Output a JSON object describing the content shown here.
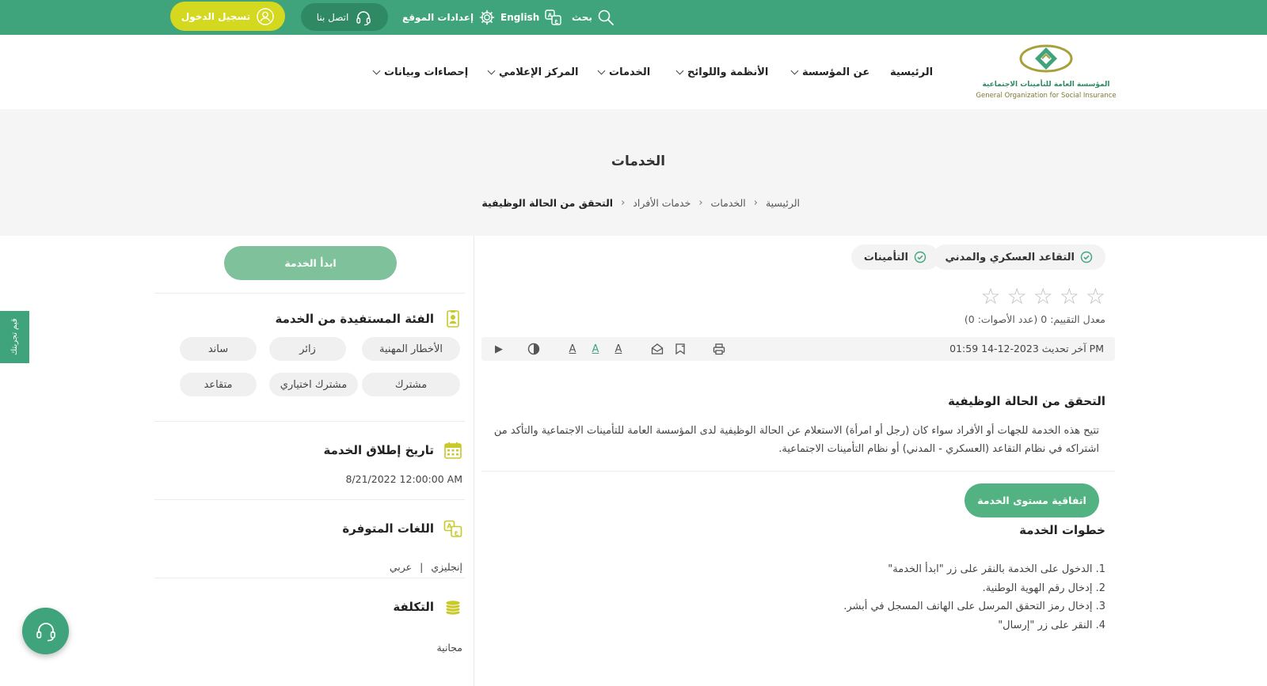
{
  "topbar": {
    "login_label": "تسجيل الدخول",
    "contact_label": "اتصل بنا",
    "settings_label": "إعدادات الموقع",
    "language_label": "English",
    "search_label": "بحث"
  },
  "header": {
    "logo_ar": "المؤسسة العامة للتأمينات الاجتماعية",
    "logo_en": "General Organization for Social Insurance",
    "nav": {
      "home": "الرئيسية",
      "about": "عن المؤسسة",
      "regulations": "الأنظمة واللوائح",
      "services": "الخدمات",
      "media": "المركز الإعلامي",
      "statistics": "إحصاءات وبيانات"
    }
  },
  "banner": {
    "title": "الخدمات",
    "breadcrumb": {
      "home": "الرئيسية",
      "services": "الخدمات",
      "individuals": "خدمات الأفراد",
      "current": "التحقق من الحالة الوظيفية",
      "separator": "›"
    }
  },
  "side_tab": {
    "label": "قيم تجربتك"
  },
  "sidebar": {
    "start_label": "ابدأ الخدمة",
    "beneficiaries_title": "الفئة المستفيدة من الخدمة",
    "beneficiaries": [
      "الأخطار المهنية",
      "زائر",
      "ساند",
      "مشترك",
      "مشترك اختياري",
      "متقاعد"
    ],
    "launch_title": "تاريخ إطلاق الخدمة",
    "launch_value": "8/21/2022 12:00:00 AM",
    "languages_title": "اللغات المتوفرة",
    "languages": [
      "إنجليزي",
      "عربي"
    ],
    "languages_separator": "|",
    "cost_title": "التكلفة",
    "cost_value": "مجانية"
  },
  "main": {
    "tags": [
      "التقاعد العسكري والمدني",
      "التأمينات"
    ],
    "stars_total": 5,
    "star_glyph": "☆",
    "rating_text": "معدل التقييم: 0 (عدد الأصوات: 0)",
    "last_update": "آخر تحديث 2023-12-14 01:59 PM",
    "toolbar": {
      "play": "▶",
      "font_down": "A",
      "font_reset": "A",
      "font_up": "A"
    },
    "service_title": "التحقق من الحالة الوظيفية",
    "service_description": "تتيح هذه الخدمة للجهات أو الأفراد سواء كان (رجل أو امرأة) الاستعلام عن الحالة الوظيفية لدى المؤسسة العامة للتأمينات الاجتماعية والتأكد من اشتراكه في نظام التقاعد (العسكري - المدني) أو نظام التأمينات الاجتماعية.",
    "sla_label": "اتفاقية مستوى الخدمة",
    "steps_title": "خطوات الخدمة",
    "steps": [
      "1. الدخول على الخدمة بالنقر على زر \"ابدأ الخدمة\"",
      "2. إدخال رقم الهوية الوطنية.",
      "3. إدخال رمز التحقق المرسل على الهاتف المسجل في أبشر.",
      "4. النقر على زر \"إرسال\""
    ]
  },
  "colors": {
    "brand_green": "#3fa47c",
    "login_yellow": "#d4d81e",
    "start_button": "#7ec19a",
    "sla_button": "#52b281",
    "icon_gold": "#c9c92a"
  }
}
